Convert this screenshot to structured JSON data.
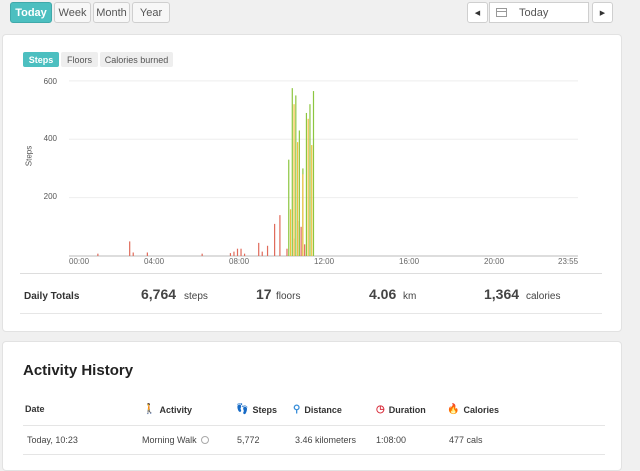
{
  "toolbar": {
    "ranges": [
      "Today",
      "Week",
      "Month",
      "Year"
    ],
    "date_value": "Today",
    "prev_icon": "◀",
    "next_icon": "▶"
  },
  "chart_tabs": [
    "Steps",
    "Floors",
    "Calories burned"
  ],
  "chart_data": {
    "type": "bar",
    "ylabel": "Steps",
    "xlim": [
      "00:00",
      "24:00"
    ],
    "ylim": [
      0,
      620
    ],
    "yticks": [
      200,
      400,
      600
    ],
    "xtick_labels": [
      "00:00",
      "04:00",
      "08:00",
      "12:00",
      "16:00",
      "20:00",
      "23:55"
    ],
    "grid": true,
    "series": [
      {
        "color": "#e06a5a",
        "x": [
          "01:20",
          "02:50",
          "03:00",
          "03:40",
          "06:15",
          "07:35",
          "07:45",
          "07:55",
          "08:05",
          "08:15",
          "08:55",
          "09:05",
          "09:20",
          "09:40",
          "09:55",
          "10:15",
          "10:35",
          "10:45",
          "10:55",
          "11:05"
        ],
        "y": [
          8,
          50,
          12,
          12,
          8,
          10,
          15,
          25,
          25,
          8,
          45,
          15,
          35,
          110,
          140,
          25,
          60,
          120,
          100,
          40
        ]
      },
      {
        "color": "#8cc63f",
        "x": [
          "10:20",
          "10:30",
          "10:40",
          "10:50",
          "11:00",
          "11:10",
          "11:20",
          "11:30"
        ],
        "y": [
          330,
          575,
          550,
          430,
          300,
          490,
          520,
          565
        ]
      },
      {
        "color": "#f0c040",
        "x": [
          "10:25",
          "10:35",
          "10:45",
          "11:00",
          "11:15",
          "11:25"
        ],
        "y": [
          160,
          520,
          390,
          280,
          470,
          380
        ]
      }
    ]
  },
  "daily_totals": {
    "label": "Daily Totals",
    "steps_value": "6,764",
    "steps_unit": "steps",
    "floors_value": "17",
    "floors_unit": "floors",
    "distance_value": "4.06",
    "distance_unit": "km",
    "calories_value": "1,364",
    "calories_unit": "calories"
  },
  "activity_history": {
    "title": "Activity History",
    "columns": {
      "date": "Date",
      "activity": "Activity",
      "steps": "Steps",
      "distance": "Distance",
      "duration": "Duration",
      "calories": "Calories"
    },
    "icons": {
      "activity": "walker-icon",
      "steps": "footprints-icon",
      "distance": "distance-icon",
      "duration": "clock-icon",
      "calories": "flame-icon"
    },
    "rows": [
      {
        "date": "Today, 10:23",
        "activity": "Morning Walk",
        "steps": "5,772",
        "distance": "3.46 kilometers",
        "duration": "1:08:00",
        "calories": "477 cals"
      }
    ]
  }
}
